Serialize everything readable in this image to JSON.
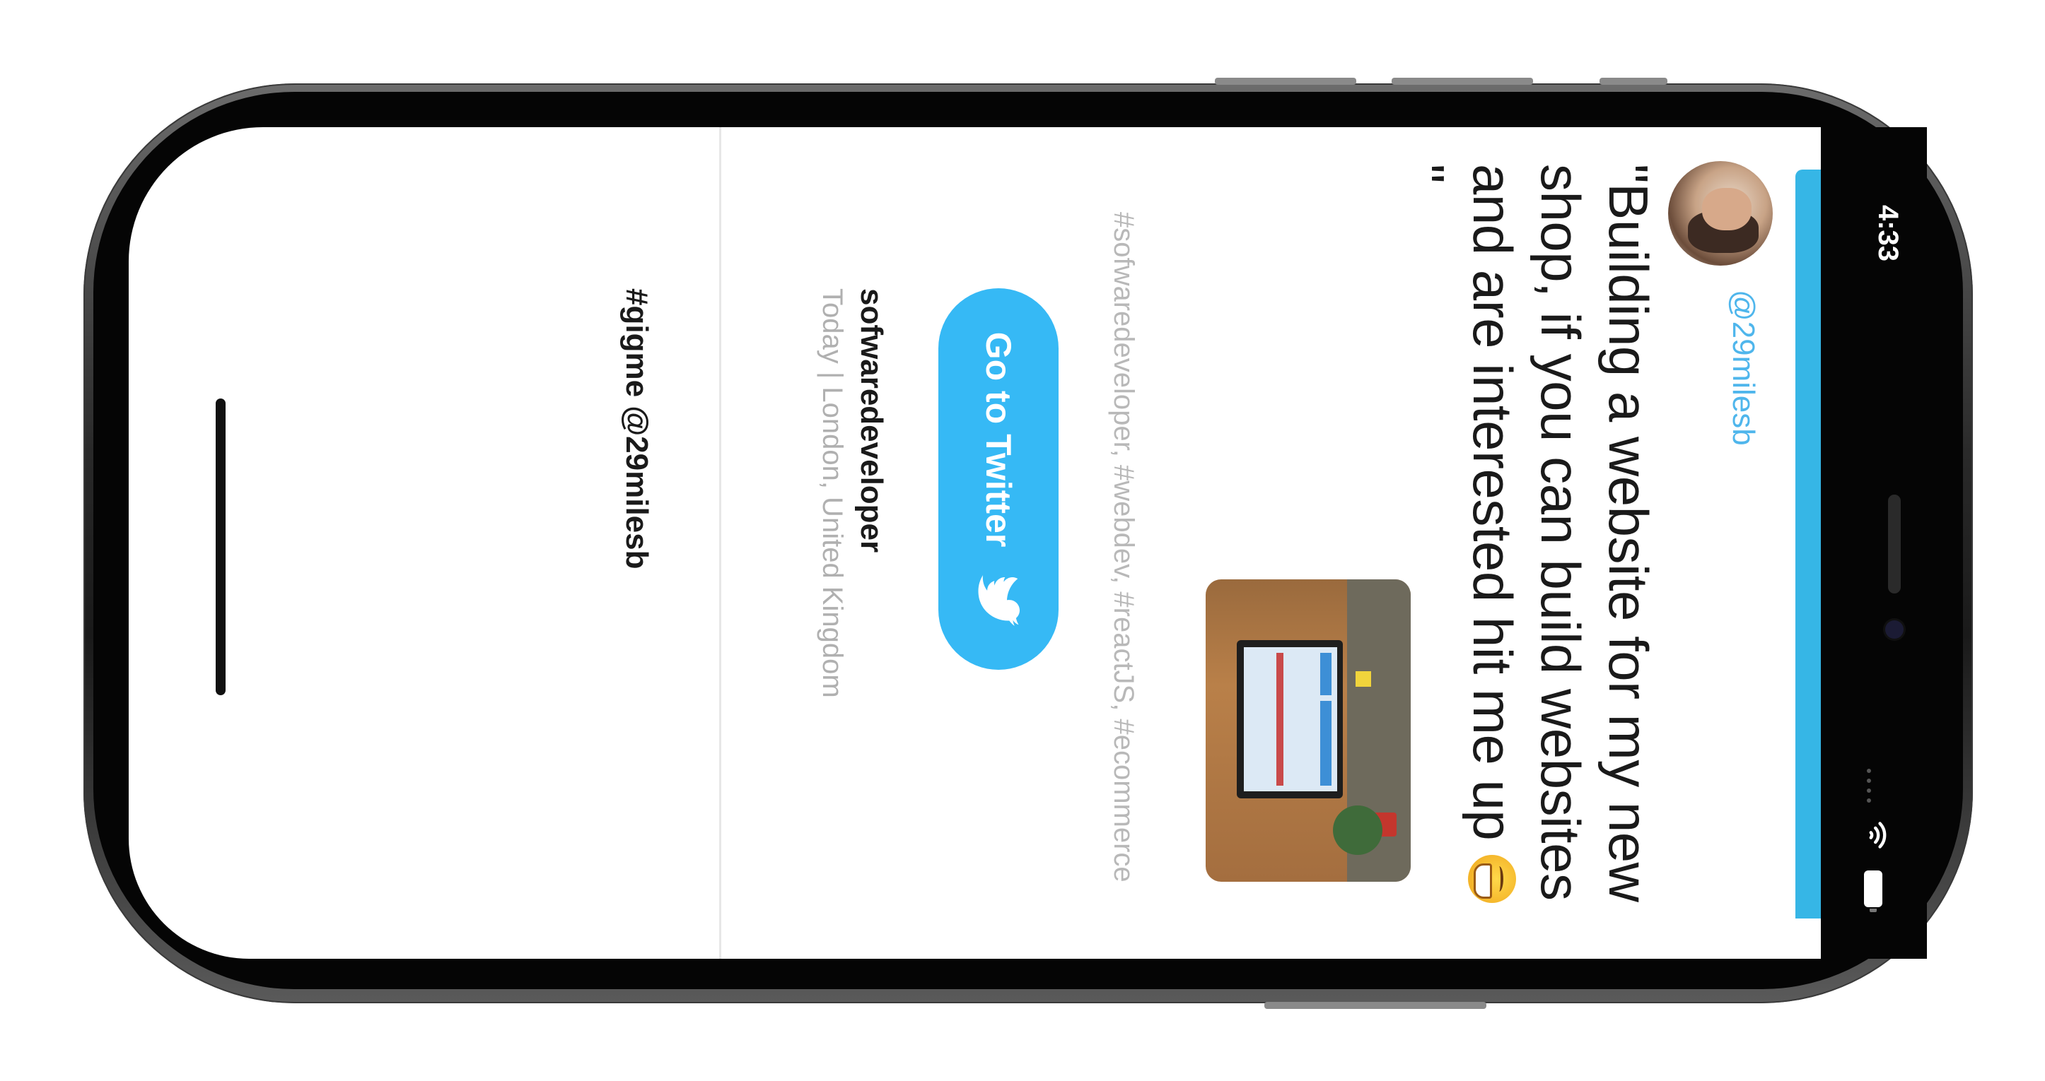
{
  "status_bar": {
    "time": "4:33"
  },
  "tweet": {
    "handle": "@29milesb",
    "text": "\"Building a website for my new shop, if you can build websites and are interested hit me up ",
    "text_end": " \"",
    "hashtags": "#sofwaredeveloper, #webdev, #reactJS, #ecommerce",
    "button_label": "Go to Twitter",
    "author": "sofwaredeveloper",
    "meta": "Today | London, United Kingdom",
    "footer_tag": "#gigme @29milesb"
  },
  "icons": {
    "avatar": "avatar",
    "emoji": "grinning-face-emoji",
    "bird": "twitter-bird-icon",
    "wifi": "wifi-icon",
    "battery": "battery-icon"
  },
  "colors": {
    "accent": "#36b9f5",
    "handle": "#4fb6ec",
    "strip": "#36b6e6"
  }
}
